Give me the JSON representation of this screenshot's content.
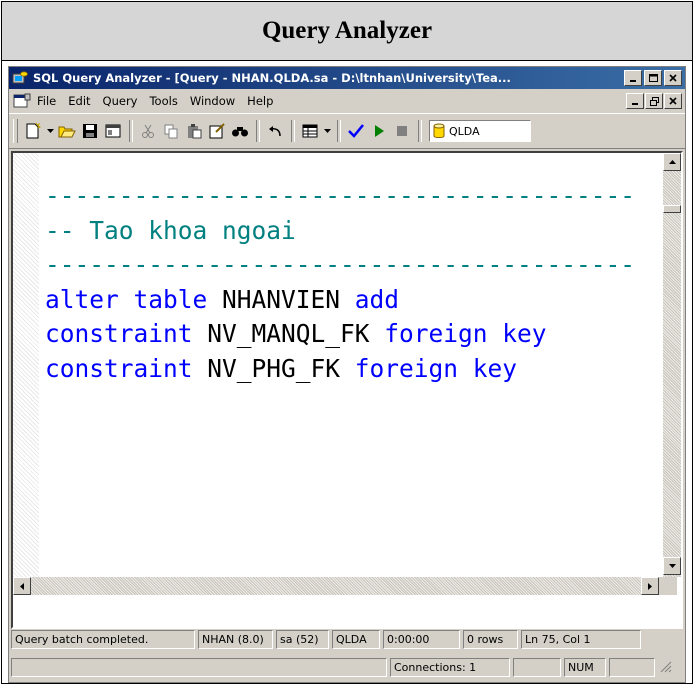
{
  "header": {
    "title": "Query Analyzer"
  },
  "window": {
    "title": "SQL Query Analyzer - [Query - NHAN.QLDA.sa - D:\\ltnhan\\University\\Tea...",
    "caption_buttons": [
      "minimize-icon",
      "maximize-icon",
      "close-icon"
    ]
  },
  "menu": {
    "items": [
      "File",
      "Edit",
      "Query",
      "Tools",
      "Window",
      "Help"
    ]
  },
  "toolbar": {
    "database": "QLDA",
    "icons": [
      "new-query-icon",
      "open-icon",
      "save-icon",
      "insert-template-icon",
      "cut-icon",
      "copy-icon",
      "paste-icon",
      "clear-window-icon",
      "find-icon",
      "undo-icon",
      "results-grid-icon",
      "parse-icon",
      "execute-icon",
      "stop-icon",
      "database-icon"
    ],
    "colors": {
      "execute": "#008000",
      "parse": "#0000ff"
    }
  },
  "editor": {
    "lines": [
      {
        "parts": [
          {
            "t": "----------------------------------------",
            "c": "cm"
          }
        ]
      },
      {
        "parts": [
          {
            "t": "-- Tao khoa ngoai",
            "c": "cm"
          }
        ]
      },
      {
        "parts": [
          {
            "t": "----------------------------------------",
            "c": "cm"
          }
        ]
      },
      {
        "parts": [
          {
            "t": "alter table ",
            "c": "kw"
          },
          {
            "t": "NHANVIEN ",
            "c": "id"
          },
          {
            "t": "add",
            "c": "kw"
          }
        ]
      },
      {
        "parts": [
          {
            "t": "constraint ",
            "c": "kw"
          },
          {
            "t": "NV_MANQL_FK ",
            "c": "id"
          },
          {
            "t": "foreign key",
            "c": "kw"
          }
        ]
      },
      {
        "parts": [
          {
            "t": "constraint ",
            "c": "kw"
          },
          {
            "t": "NV_PHG_FK ",
            "c": "id"
          },
          {
            "t": "foreign key",
            "c": "kw"
          }
        ]
      }
    ],
    "colors": {
      "comment": "#008080",
      "keyword": "#0000ff",
      "identifier": "#000000"
    }
  },
  "status": {
    "message": "Query batch completed.",
    "server": "NHAN (8.0)",
    "user": "sa (52)",
    "database": "QLDA",
    "elapsed": "0:00:00",
    "rows": "0 rows",
    "position": "Ln 75, Col 1",
    "connections": "Connections: 1",
    "num": "NUM"
  }
}
